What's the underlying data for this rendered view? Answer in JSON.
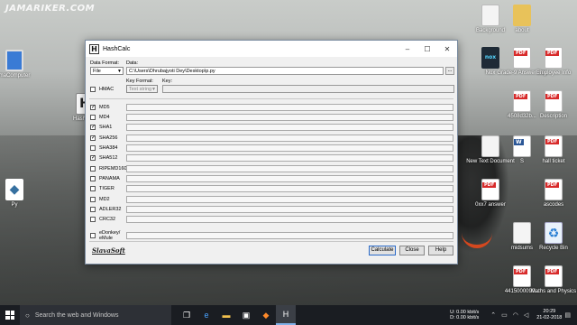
{
  "watermark": "JAMARIKER.COM",
  "desktop_icons": [
    {
      "id": "mscomputer",
      "label": "maComputer",
      "icon": "monitor-icon",
      "kind": "monitor"
    },
    {
      "id": "hashcalc",
      "label": "HashCalc",
      "icon": "hashcalc-icon",
      "kind": "hash"
    },
    {
      "id": "python",
      "label": "Py",
      "icon": "python-icon",
      "kind": "python"
    },
    {
      "id": "background",
      "label": "Background",
      "icon": "document-icon",
      "kind": "doc"
    },
    {
      "id": "about",
      "label": "about",
      "icon": "folder-icon",
      "kind": "folder"
    },
    {
      "id": "nox",
      "label": "Nox",
      "icon": "nox-icon",
      "kind": "nox"
    },
    {
      "id": "grade",
      "label": "Grade-9 Answer Key",
      "icon": "pdf-icon",
      "kind": "pdf"
    },
    {
      "id": "employee",
      "label": "Employee Info",
      "icon": "pdf-icon",
      "kind": "pdf"
    },
    {
      "id": "pdf-4508",
      "label": "4508d32b...",
      "icon": "pdf-icon",
      "kind": "pdf"
    },
    {
      "id": "description",
      "label": "Description",
      "icon": "pdf-icon",
      "kind": "pdf"
    },
    {
      "id": "newtext",
      "label": "New Text Document",
      "icon": "document-icon",
      "kind": "doc"
    },
    {
      "id": "word-s",
      "label": "S",
      "icon": "word-icon",
      "kind": "word"
    },
    {
      "id": "hallticket",
      "label": "hall ticket",
      "icon": "pdf-icon",
      "kind": "pdf"
    },
    {
      "id": "answer",
      "label": "0xx7 answer",
      "icon": "pdf-icon",
      "kind": "pdf"
    },
    {
      "id": "ascodes",
      "label": "ascodes",
      "icon": "pdf-icon",
      "kind": "pdf"
    },
    {
      "id": "midsums",
      "label": "midsums",
      "icon": "document-icon",
      "kind": "doc"
    },
    {
      "id": "recycle",
      "label": "Recycle Bin",
      "icon": "recycle-bin-icon",
      "kind": "recycle"
    },
    {
      "id": "pdf-4415",
      "label": "4415000099...",
      "icon": "pdf-icon",
      "kind": "pdf"
    },
    {
      "id": "maths",
      "label": "Maths and Physics",
      "icon": "pdf-icon",
      "kind": "pdf"
    }
  ],
  "window": {
    "title": "HashCalc",
    "app_icon_letter": "H",
    "minimize": "–",
    "maximize": "☐",
    "close": "✕"
  },
  "form": {
    "data_format_label": "Data Format:",
    "data_format_value": "File",
    "data_label": "Data:",
    "data_value": "C:\\Users\\Dhrubajyoti Dey\\Desktop\\p.py",
    "browse_label": "...",
    "hmac_label": "HMAC",
    "hmac_checked": false,
    "key_format_label": "Key Format:",
    "key_format_value": "Text string",
    "key_label": "Key:",
    "key_value": ""
  },
  "algorithms": [
    {
      "name": "MD5",
      "checked": true
    },
    {
      "name": "MD4",
      "checked": false
    },
    {
      "name": "SHA1",
      "checked": true
    },
    {
      "name": "SHA256",
      "checked": true
    },
    {
      "name": "SHA384",
      "checked": false
    },
    {
      "name": "SHA512",
      "checked": true
    },
    {
      "name": "RIPEMD160",
      "checked": false
    },
    {
      "name": "PANAMA",
      "checked": false
    },
    {
      "name": "TIGER",
      "checked": false
    },
    {
      "name": "MD2",
      "checked": false
    },
    {
      "name": "ADLER32",
      "checked": false
    },
    {
      "name": "CRC32",
      "checked": false
    },
    {
      "name": "eDonkey/ eMule",
      "checked": false
    }
  ],
  "footer": {
    "logo": "SlavaSoft",
    "calculate": "Calculate",
    "close": "Close",
    "help": "Help"
  },
  "taskbar": {
    "search_placeholder": "Search the web and Windows",
    "apps": [
      {
        "name": "task-view",
        "glyph": "❐",
        "active": false
      },
      {
        "name": "edge",
        "glyph": "e",
        "active": false
      },
      {
        "name": "file-explorer",
        "glyph": "▬",
        "active": false
      },
      {
        "name": "store",
        "glyph": "▣",
        "active": false
      },
      {
        "name": "app-orange",
        "glyph": "◆",
        "active": false
      },
      {
        "name": "hashcalc",
        "glyph": "H",
        "active": true
      }
    ],
    "net_up": "0.00 kbit/s",
    "net_down": "0.00 kbit/s",
    "time": "20:29",
    "date": "21-02-2018"
  }
}
